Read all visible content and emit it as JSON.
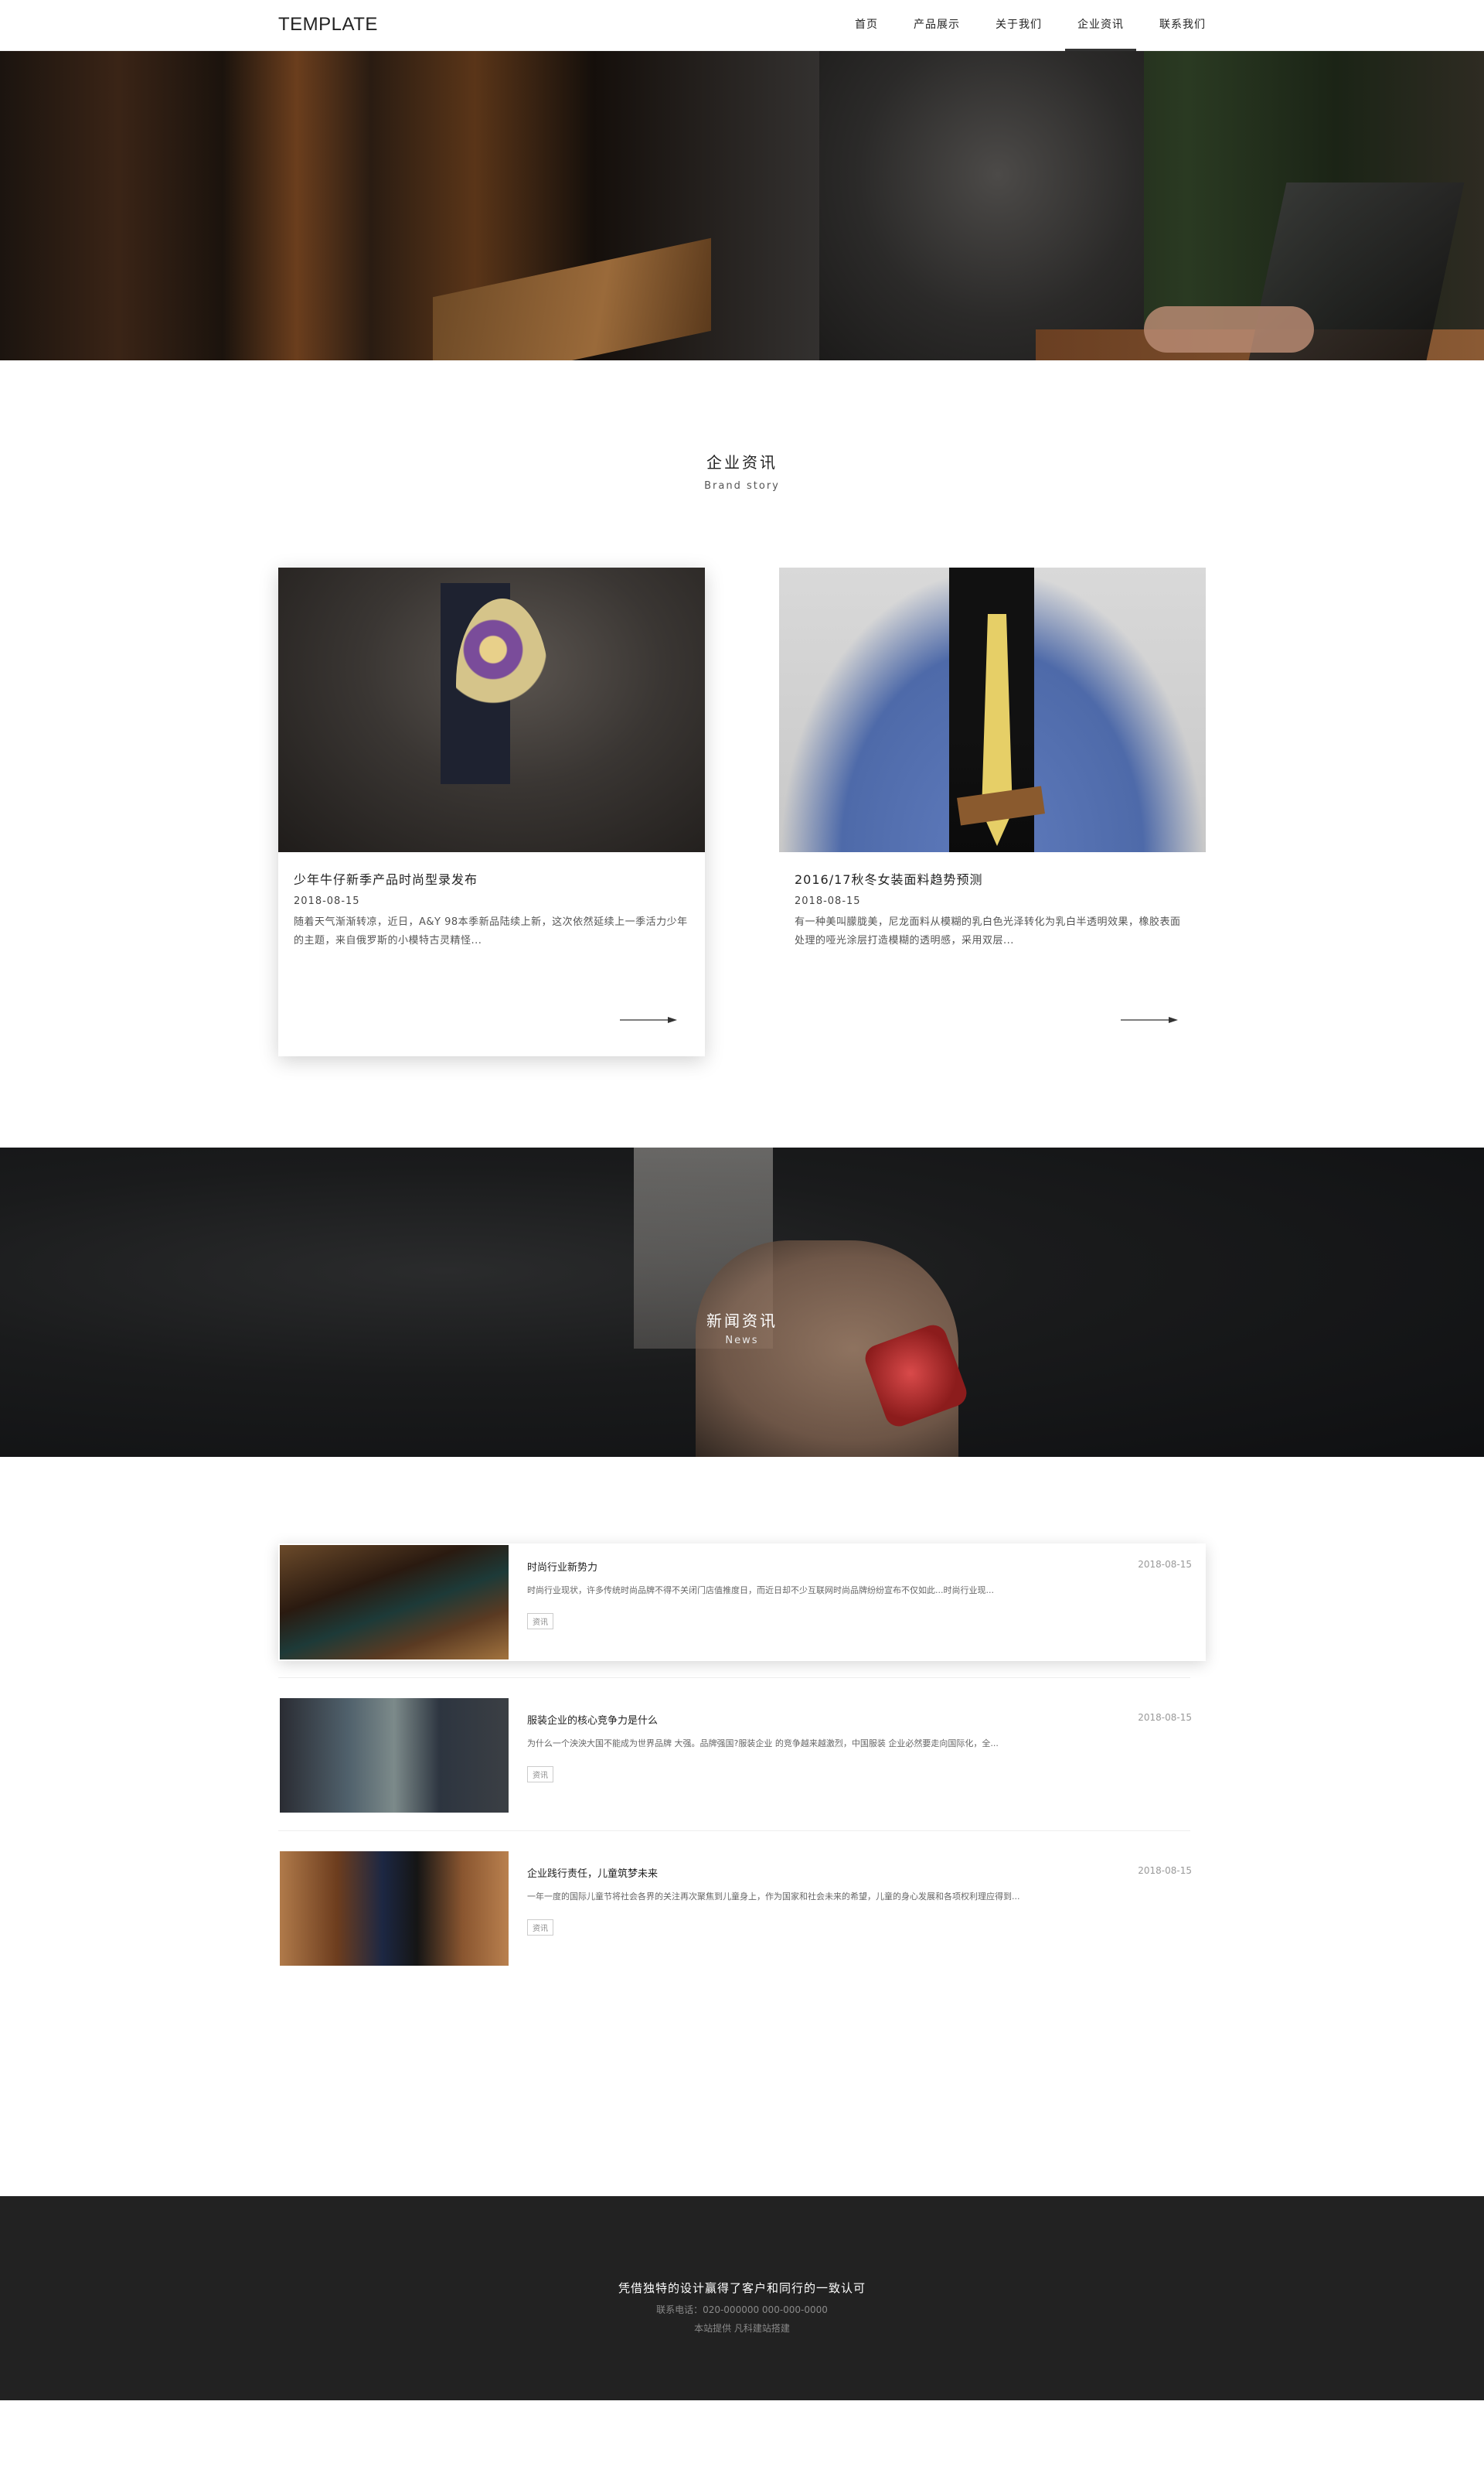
{
  "header": {
    "logo": "TEMPLATE",
    "nav": [
      "首页",
      "产品展示",
      "关于我们",
      "企业资讯",
      "联系我们"
    ],
    "active_nav": "企业资讯"
  },
  "brand": {
    "title_cn": "企业资讯",
    "title_en": "Brand story",
    "cards": [
      {
        "title": "少年牛仔新季产品时尚型录发布",
        "date": "2018-08-15",
        "desc": "随着天气渐渐转凉，近日，A&Y 98本季新品陆续上新，这次依然延续上一季活力少年的主题，来自俄罗斯的小模特古灵精怪..."
      },
      {
        "title": "2016/17秋冬女装面料趋势预测",
        "date": "2018-08-15",
        "desc": "有一种美叫朦胧美，尼龙面料从模糊的乳白色光泽转化为乳白半透明效果，橡胶表面处理的哑光涂层打造模糊的透明感，采用双层..."
      }
    ]
  },
  "news_banner": {
    "title_cn": "新闻资讯",
    "title_en": "News"
  },
  "news": [
    {
      "title": "时尚行业新势力",
      "date": "2018-08-15",
      "desc": "时尚行业现状，许多传统时尚品牌不得不关闭门店值推度日，而近日却不少互联网时尚品牌纷纷宣布不仅如此...时尚行业现...",
      "tag": "资讯"
    },
    {
      "title": "服装企业的核心竞争力是什么",
      "date": "2018-08-15",
      "desc": "为什么一个泱泱大国不能成为世界品牌 大强。品牌强国?服装企业 的竞争越来越激烈，中国服装 企业必然要走向国际化，全...",
      "tag": "资讯"
    },
    {
      "title": "企业践行责任，儿童筑梦未来",
      "date": "2018-08-15",
      "desc": "一年一度的国际儿童节将社会各界的关注再次聚焦到儿童身上，作为国家和社会未来的希望，儿童的身心发展和各项权利理应得到...",
      "tag": "资讯"
    }
  ],
  "footer": {
    "slogan": "凭借独特的设计赢得了客户和同行的一致认可",
    "phone": "联系电话：020-000000  000-000-0000",
    "copyright": "本站提供  凡科建站搭建"
  }
}
